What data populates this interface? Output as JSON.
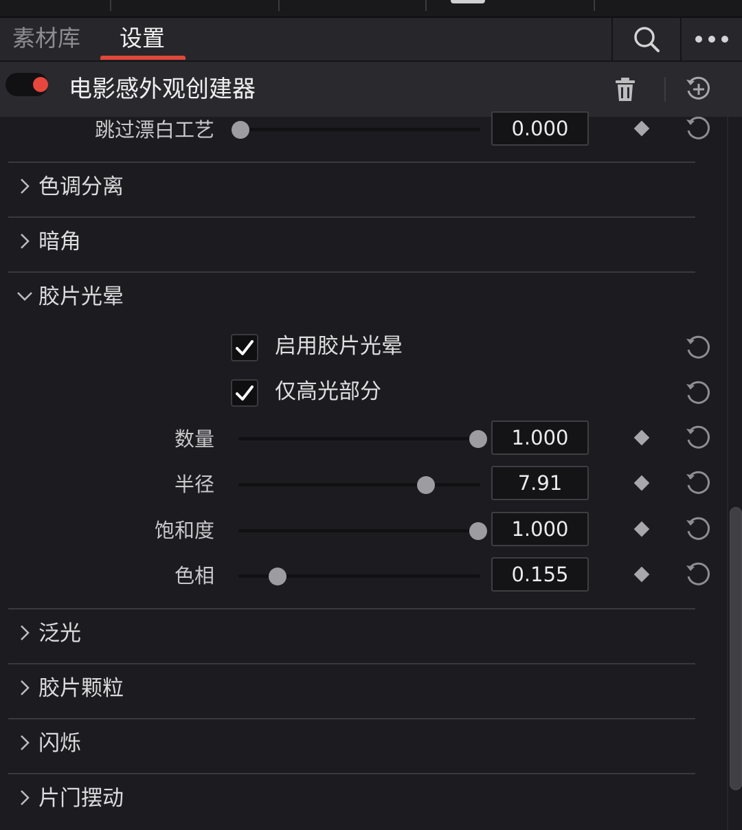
{
  "tabs": [
    {
      "label": "素材库",
      "active": false
    },
    {
      "label": "设置",
      "active": true
    }
  ],
  "effect": {
    "title": "电影感外观创建器",
    "enabled": true
  },
  "colors": {
    "accent": "#e0483b",
    "toggle_on": "#e8473d",
    "background": "#1c1c20"
  },
  "top_partial_row": {
    "label": "跳过漂白工艺",
    "value": "0.000",
    "fraction": 0.0
  },
  "sections_before": [
    {
      "label": "色调分离",
      "expanded": false
    },
    {
      "label": "暗角",
      "expanded": false
    }
  ],
  "open_section": {
    "label": "胶片光晕",
    "expanded": true,
    "checkboxes": [
      {
        "label": "启用胶片光晕",
        "checked": true
      },
      {
        "label": "仅高光部分",
        "checked": true
      }
    ],
    "sliders": [
      {
        "label": "数量",
        "value": "1.000",
        "fraction": 1.0
      },
      {
        "label": "半径",
        "value": "7.91",
        "fraction": 0.78
      },
      {
        "label": "饱和度",
        "value": "1.000",
        "fraction": 1.0
      },
      {
        "label": "色相",
        "value": "0.155",
        "fraction": 0.155
      }
    ]
  },
  "sections_after": [
    {
      "label": "泛光",
      "expanded": false
    },
    {
      "label": "胶片颗粒",
      "expanded": false
    },
    {
      "label": "闪烁",
      "expanded": false
    },
    {
      "label": "片门摆动",
      "expanded": false
    }
  ],
  "icons": {
    "search": "search-icon",
    "more": "more-icon",
    "delete": "trash-icon",
    "reset_all": "reset-all-icon",
    "reset": "reset-icon",
    "keyframe": "keyframe-diamond-icon",
    "collapsed": "chevron-right-icon",
    "expanded": "chevron-down-icon"
  }
}
